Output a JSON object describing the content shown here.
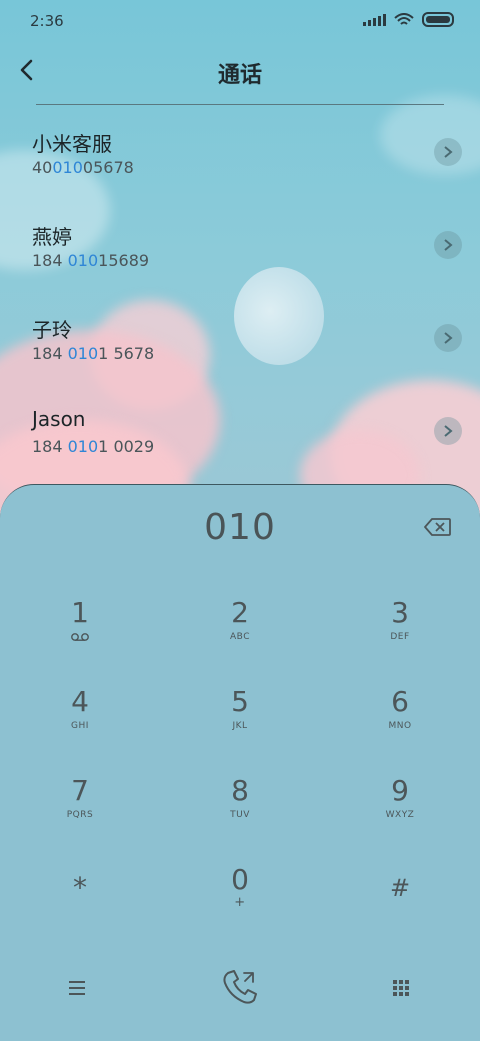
{
  "status_bar": {
    "time": "2:36"
  },
  "header": {
    "title": "通话"
  },
  "contacts": [
    {
      "name": "小米客服",
      "num_pre": "40",
      "num_hl": "010",
      "num_post": "05678"
    },
    {
      "name": "燕婷",
      "num_pre": "184 ",
      "num_hl": "010",
      "num_post": "15689"
    },
    {
      "name": "子玲",
      "num_pre": "184 ",
      "num_hl": "010",
      "num_post": "1 5678"
    },
    {
      "name": "Jason",
      "num_pre": "184 ",
      "num_hl": "010",
      "num_post": "1 0029"
    }
  ],
  "dialer": {
    "input": "010",
    "keys": [
      {
        "digit": "1",
        "sub": ""
      },
      {
        "digit": "2",
        "sub": "ABC"
      },
      {
        "digit": "3",
        "sub": "DEF"
      },
      {
        "digit": "4",
        "sub": "GHI"
      },
      {
        "digit": "5",
        "sub": "JKL"
      },
      {
        "digit": "6",
        "sub": "MNO"
      },
      {
        "digit": "7",
        "sub": "PQRS"
      },
      {
        "digit": "8",
        "sub": "TUV"
      },
      {
        "digit": "9",
        "sub": "WXYZ"
      },
      {
        "digit": "*",
        "sub": ""
      },
      {
        "digit": "0",
        "sub": "+"
      },
      {
        "digit": "#",
        "sub": ""
      }
    ]
  },
  "colors": {
    "highlight": "#2f86d6",
    "panel": "#8dc1d1"
  },
  "icons": [
    "back-icon",
    "chevron-right-icon",
    "backspace-icon",
    "voicemail-icon",
    "menu-icon",
    "phone-icon",
    "keypad-icon"
  ]
}
